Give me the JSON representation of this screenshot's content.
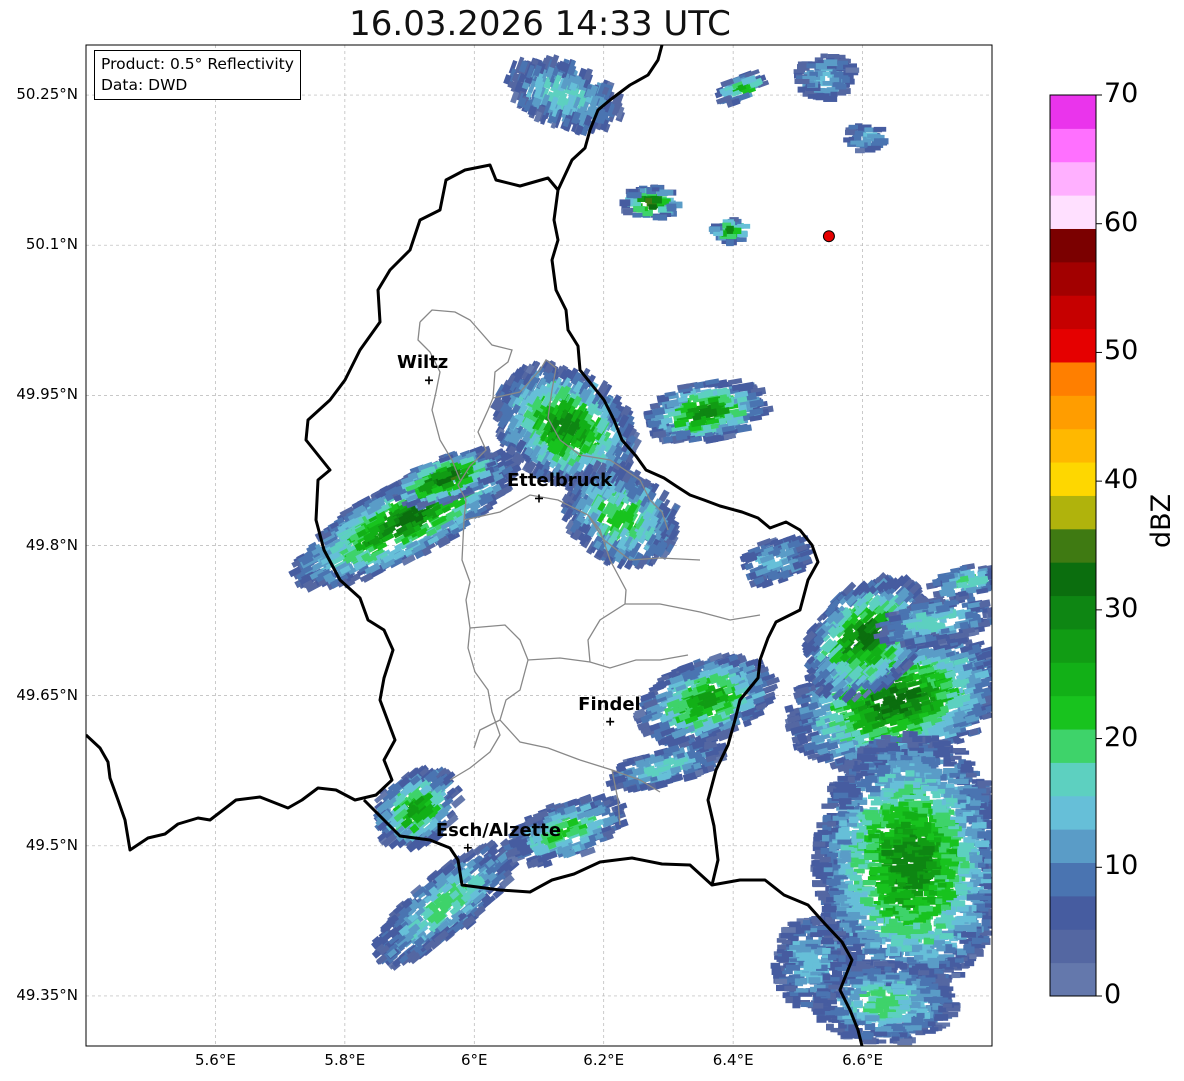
{
  "title": "16.03.2026 14:33 UTC",
  "info": {
    "product": "Product: 0.5° Reflectivity",
    "data": "Data: DWD"
  },
  "lat_ticks": [
    "50.25°N",
    "50.1°N",
    "49.95°N",
    "49.8°N",
    "49.65°N",
    "49.5°N",
    "49.35°N"
  ],
  "lon_ticks": [
    "5.6°E",
    "5.8°E",
    "6°E",
    "6.2°E",
    "6.4°E",
    "6.6°E"
  ],
  "cities": [
    {
      "name": "Wiltz",
      "lon": 5.93,
      "lat": 49.965
    },
    {
      "name": "Ettelbruck",
      "lon": 6.1,
      "lat": 49.847
    },
    {
      "name": "Findel",
      "lon": 6.21,
      "lat": 49.624
    },
    {
      "name": "Esch/Alzette",
      "lon": 5.99,
      "lat": 49.498
    }
  ],
  "radar_site": {
    "lon": 6.548,
    "lat": 50.109
  },
  "colorbar": {
    "label": "dBZ",
    "ticks": [
      "0",
      "10",
      "20",
      "30",
      "40",
      "50",
      "60",
      "70"
    ],
    "colors": [
      "#6478ac",
      "#5467a2",
      "#465ca0",
      "#4a74b1",
      "#5a9cc7",
      "#66bfd8",
      "#5dd0c0",
      "#3ed36a",
      "#18c31e",
      "#12b017",
      "#119c14",
      "#0e8613",
      "#0b6e0e",
      "#3f7a12",
      "#b0b30c",
      "#fed700",
      "#ffb800",
      "#ff9d00",
      "#ff7f00",
      "#e50000",
      "#c60000",
      "#a20000",
      "#7b0000",
      "#ffe0ff",
      "#ffb0ff",
      "#ff70ff",
      "#ea34ec"
    ]
  },
  "extent": {
    "lon_min": 5.4,
    "lon_max": 6.8,
    "lat_min": 49.3,
    "lat_max": 50.3
  }
}
